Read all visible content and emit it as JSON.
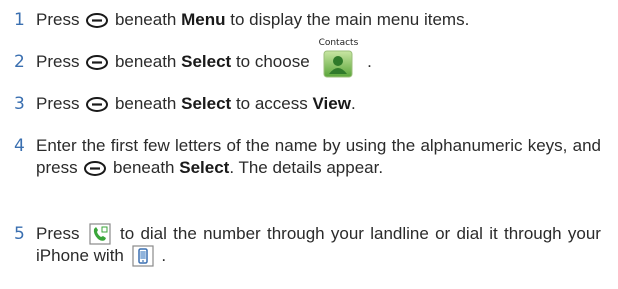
{
  "steps": [
    {
      "number": "1",
      "parts": [
        "Press",
        "beneath",
        "Menu",
        "to display the main menu items."
      ]
    },
    {
      "number": "2",
      "parts": [
        "Press",
        "beneath",
        "Select",
        "to choose",
        "."
      ],
      "icon_label": "Contacts"
    },
    {
      "number": "3",
      "parts": [
        "Press",
        "beneath",
        "Select",
        "to access",
        "View",
        "."
      ]
    },
    {
      "number": "4",
      "parts": [
        "Enter the first few letters of the name by using the alphanumeric keys, and press",
        "beneath",
        "Select",
        ". The details appear."
      ]
    },
    {
      "number": "5",
      "parts": [
        "Press",
        "to dial the number through your landline or dial it through your iPhone with",
        "."
      ]
    }
  ],
  "colors": {
    "accent_number": "#3a6fb0",
    "green_icon": "#3aa63a",
    "icon_border": "#8a8a8a"
  },
  "icons": [
    "softkey-icon",
    "contacts-icon",
    "landline-call-icon",
    "iphone-icon"
  ]
}
